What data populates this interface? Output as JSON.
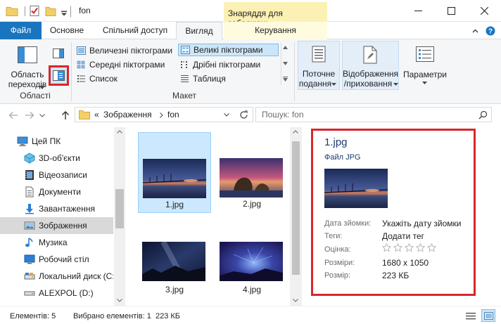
{
  "window": {
    "title": "fon",
    "context_tab_header": "Знаряддя для зображень"
  },
  "tabs": [
    {
      "label": "Файл"
    },
    {
      "label": "Основне"
    },
    {
      "label": "Спільний доступ"
    },
    {
      "label": "Вигляд"
    },
    {
      "label": "Керування"
    }
  ],
  "ribbon": {
    "panes": {
      "nav_pane_label_1": "Область",
      "nav_pane_label_2": "переходів",
      "group_label": "Області"
    },
    "layout": {
      "group_label": "Макет",
      "items": [
        {
          "label": "Величезні піктограми"
        },
        {
          "label": "Великі піктограми"
        },
        {
          "label": "Середні піктограми"
        },
        {
          "label": "Дрібні піктограми"
        },
        {
          "label": "Список"
        },
        {
          "label": "Таблиця"
        }
      ]
    },
    "current_view_1": "Поточне",
    "current_view_2": "подання",
    "show_hide_1": "Відображення",
    "show_hide_2": "/приховання",
    "options": "Параметри"
  },
  "address": {
    "overflow": "«",
    "crumbs": [
      "Зображення",
      "fon"
    ],
    "search_placeholder": "Пошук: fon"
  },
  "nav_items": [
    {
      "label": "Цей ПК",
      "icon": "pc-icon"
    },
    {
      "label": "3D-об'єкти",
      "icon": "3d-objects-icon"
    },
    {
      "label": "Відеозаписи",
      "icon": "video-icon"
    },
    {
      "label": "Документи",
      "icon": "documents-icon"
    },
    {
      "label": "Завантаження",
      "icon": "download-icon"
    },
    {
      "label": "Зображення",
      "icon": "pictures-icon"
    },
    {
      "label": "Музика",
      "icon": "music-icon"
    },
    {
      "label": "Робочий стіл",
      "icon": "desktop-icon"
    },
    {
      "label": "Локальний диск (C:",
      "icon": "drive-icon"
    },
    {
      "label": "ALEXPOL (D:)",
      "icon": "drive-icon"
    }
  ],
  "files": [
    {
      "name": "1.jpg",
      "selected": true
    },
    {
      "name": "2.jpg",
      "selected": false
    },
    {
      "name": "3.jpg",
      "selected": false
    },
    {
      "name": "4.jpg",
      "selected": false
    }
  ],
  "details": {
    "filename": "1.jpg",
    "filetype": "Файл JPG",
    "rows": [
      {
        "label": "Дата зйомки:",
        "value": "Укажіть дату зйомки"
      },
      {
        "label": "Теги:",
        "value": "Додати тег"
      },
      {
        "label": "Оцінка:",
        "value": ""
      },
      {
        "label": "Розміри:",
        "value": "1680 x 1050"
      },
      {
        "label": "Розмір:",
        "value": "223 КБ"
      }
    ],
    "rating": 0,
    "rating_max": 5
  },
  "status": {
    "items_count": "Елементів: 5",
    "selected": "Вибрано елементів: 1  223 КБ"
  },
  "colors": {
    "file_tab": "#1a75bf",
    "highlight_box": "#d9262c",
    "selection": "#cce8ff",
    "context_tab": "#fbf1b4"
  }
}
